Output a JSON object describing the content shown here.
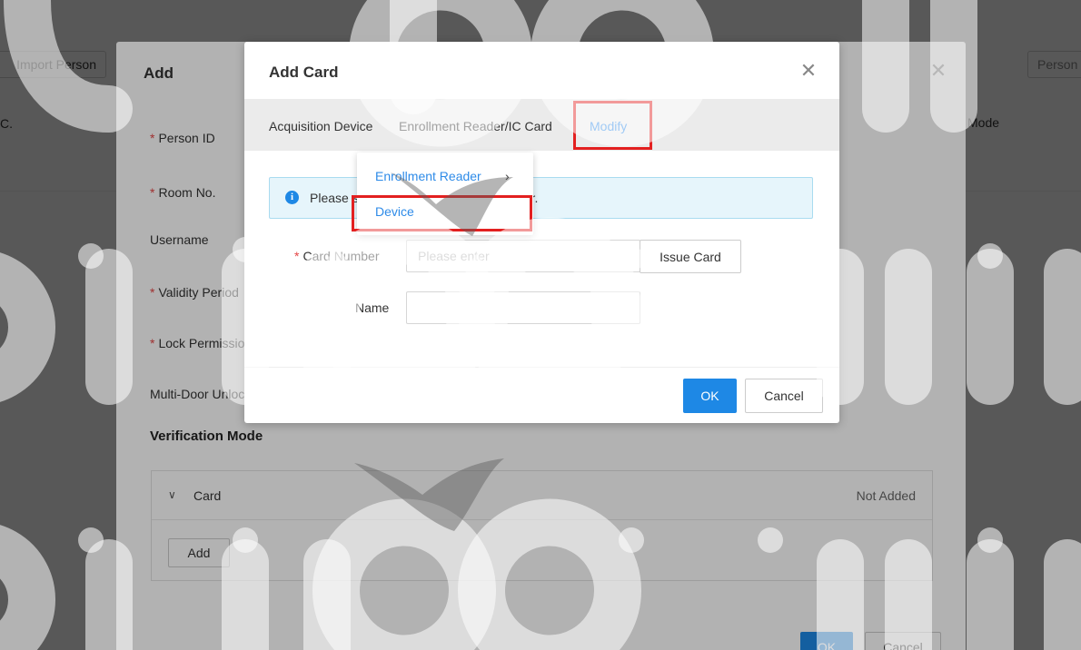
{
  "background": {
    "import_person_label": "Import Person",
    "person_label": "Person",
    "column_left": "C.",
    "column_right": "Mode"
  },
  "add_dialog": {
    "title": "Add",
    "close_icon": "close-icon",
    "fields": [
      {
        "label": "Person ID",
        "required": true
      },
      {
        "label": "Room No.",
        "required": true
      },
      {
        "label": "Username",
        "required": false
      },
      {
        "label": "Validity Period",
        "required": true
      },
      {
        "label": "Lock Permission",
        "required": true
      },
      {
        "label": "Multi-Door Unlock",
        "required": false
      }
    ],
    "verification_title": "Verification Mode",
    "card_panel": {
      "label": "Card",
      "status": "Not Added",
      "add_button": "Add"
    },
    "ok_label": "OK",
    "cancel_label": "Cancel"
  },
  "card_modal": {
    "title": "Add Card",
    "close_icon": "close-icon",
    "acquisition_label": "Acquisition Device",
    "acquisition_value": "Enrollment Reader/IC Card",
    "modify_label": "Modify",
    "info_text": "Please swipe card or enter card number.",
    "card_number_label": "Card Number",
    "card_number_placeholder": "Please enter",
    "name_label": "Name",
    "name_value": "",
    "issue_card_label": "Issue Card",
    "ok_label": "OK",
    "cancel_label": "Cancel"
  },
  "dropdown": {
    "items": [
      {
        "label": "Enrollment Reader",
        "has_submenu": true
      },
      {
        "label": "Device",
        "has_submenu": false
      }
    ]
  },
  "watermark_text": "digitklik",
  "colors": {
    "accent": "#1e88e5",
    "link": "#2e8be8",
    "highlight": "#e32020",
    "required": "#e54545"
  }
}
